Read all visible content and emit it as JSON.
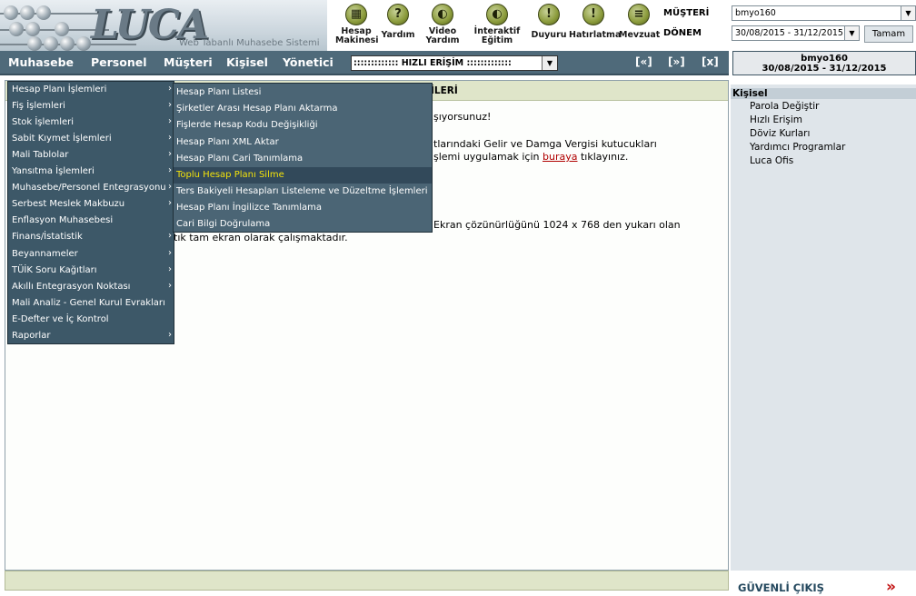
{
  "header": {
    "logo_text": "LUCA",
    "tagline": "Web Tabanlı Muhasebe Sistemi",
    "tools": [
      {
        "icon": "calculator-icon",
        "label1": "Hesap",
        "label2": "Makinesi"
      },
      {
        "icon": "help-icon",
        "label1": "Yardım",
        "label2": ""
      },
      {
        "icon": "video-help-icon",
        "label1": "Video",
        "label2": "Yardım"
      },
      {
        "icon": "interactive-training-icon",
        "label1": "İnteraktif",
        "label2": "Eğitim"
      },
      {
        "icon": "announcement-icon",
        "label1": "Duyuru",
        "label2": ""
      },
      {
        "icon": "reminder-icon",
        "label1": "Hatırlatma",
        "label2": ""
      },
      {
        "icon": "legislation-icon",
        "label1": "Mevzuat",
        "label2": ""
      }
    ],
    "musteri_label": "MÜŞTERİ",
    "donem_label": "DÖNEM",
    "musteri_value": "bmyo160",
    "donem_value": "30/08/2015 - 31/12/2015",
    "tamam": "Tamam"
  },
  "menubar": {
    "items": [
      "Muhasebe",
      "Personel",
      "Müşteri",
      "Kişisel",
      "Yönetici"
    ],
    "quick_access": "::::::::::::: HIZLI ERİŞİM :::::::::::::",
    "nav_first": "[«]",
    "nav_next": "[»]",
    "nav_close": "[x]"
  },
  "user": {
    "name": "bmyo160",
    "period": "30/08/2015 - 31/12/2015"
  },
  "main": {
    "title": "İLERİ",
    "lines": [
      "şıyorsunuz!",
      "tlarındaki Gelir ve Damga Vergisi kutucukları",
      "şlemi uygulamak için ",
      "buraya",
      " tıklayınız.",
      "Ekran çözünürlüğünü 1024 x 768 den yukarı olan",
      "tık tam ekran olarak çalışmaktadır."
    ]
  },
  "sidebar": {
    "heading": "Kişisel",
    "items": [
      "Parola Değiştir",
      "Hızlı Erişim",
      "Döviz Kurları",
      "Yardımcı Programlar",
      "Luca Ofis"
    ]
  },
  "logout": "GÜVENLİ ÇIKIŞ",
  "menu1": [
    {
      "label": "Hesap Planı İşlemleri",
      "sub": true
    },
    {
      "label": "Fiş İşlemleri",
      "sub": true
    },
    {
      "label": "Stok İşlemleri",
      "sub": true
    },
    {
      "label": "Sabit Kıymet İşlemleri",
      "sub": true
    },
    {
      "label": "Mali Tablolar",
      "sub": true
    },
    {
      "label": "Yansıtma İşlemleri",
      "sub": true
    },
    {
      "label": "Muhasebe/Personel Entegrasyonu",
      "sub": true
    },
    {
      "label": "Serbest Meslek Makbuzu",
      "sub": true
    },
    {
      "label": "Enflasyon Muhasebesi",
      "sub": false
    },
    {
      "label": "Finans/İstatistik",
      "sub": true
    },
    {
      "label": "Beyannameler",
      "sub": true
    },
    {
      "label": "TÜİK Soru Kağıtları",
      "sub": true
    },
    {
      "label": "Akıllı Entegrasyon Noktası",
      "sub": true
    },
    {
      "label": "Mali Analiz - Genel Kurul Evrakları",
      "sub": false
    },
    {
      "label": "E-Defter ve İç Kontrol",
      "sub": false
    },
    {
      "label": "Raporlar",
      "sub": true
    }
  ],
  "menu2": [
    "Hesap Planı Listesi",
    "Şirketler Arası Hesap Planı Aktarma",
    "Fişlerde Hesap Kodu Değişikliği",
    "Hesap Planı XML Aktar",
    "Hesap Planı Cari Tanımlama",
    "Toplu Hesap Planı Silme",
    "Ters Bakiyeli Hesapları Listeleme ve Düzeltme İşlemleri",
    "Hesap Planı İngilizce Tanımlama",
    "Cari Bilgi Doğrulama"
  ],
  "menu2_highlight": 5,
  "colors": {
    "menubar": "#4f6a7a",
    "menu_bg": "#3d5868",
    "highlight_text": "#f3e20b",
    "link": "#b00000"
  }
}
